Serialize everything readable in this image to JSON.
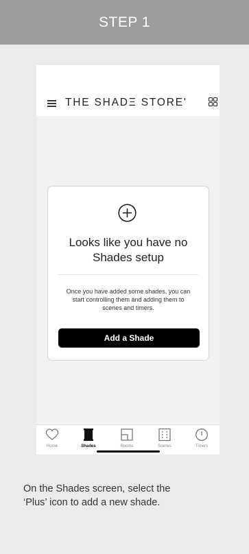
{
  "banner": {
    "title": "STEP 1"
  },
  "app": {
    "brand": "THE SHADΞ STORE'",
    "menu_icon": "hamburger-menu-icon",
    "grid_icon": "grid-icon"
  },
  "empty_state": {
    "icon": "plus-circle-icon",
    "title_line1": "Looks like you have no",
    "title_line2": "Shades setup",
    "desc_line1": "Once you have added some shades, you can",
    "desc_line2": "start controlling them and adding them to",
    "desc_line3": "scenes and timers.",
    "button": "Add a Shade"
  },
  "tabs": [
    {
      "label": "Home",
      "icon": "heart-icon",
      "active": false
    },
    {
      "label": "Shades",
      "icon": "shade-icon",
      "active": true
    },
    {
      "label": "Rooms",
      "icon": "room-icon",
      "active": false
    },
    {
      "label": "Scenes",
      "icon": "scenes-icon",
      "active": false
    },
    {
      "label": "Timers",
      "icon": "timer-icon",
      "active": false
    }
  ],
  "caption": {
    "line1": "On the Shades screen, select the",
    "line2": "‘Plus’ icon to add a new shade."
  },
  "colors": {
    "banner_bg": "#9c9c9c",
    "page_bg": "#ebebeb",
    "button_bg": "#000000",
    "text": "#333333"
  }
}
